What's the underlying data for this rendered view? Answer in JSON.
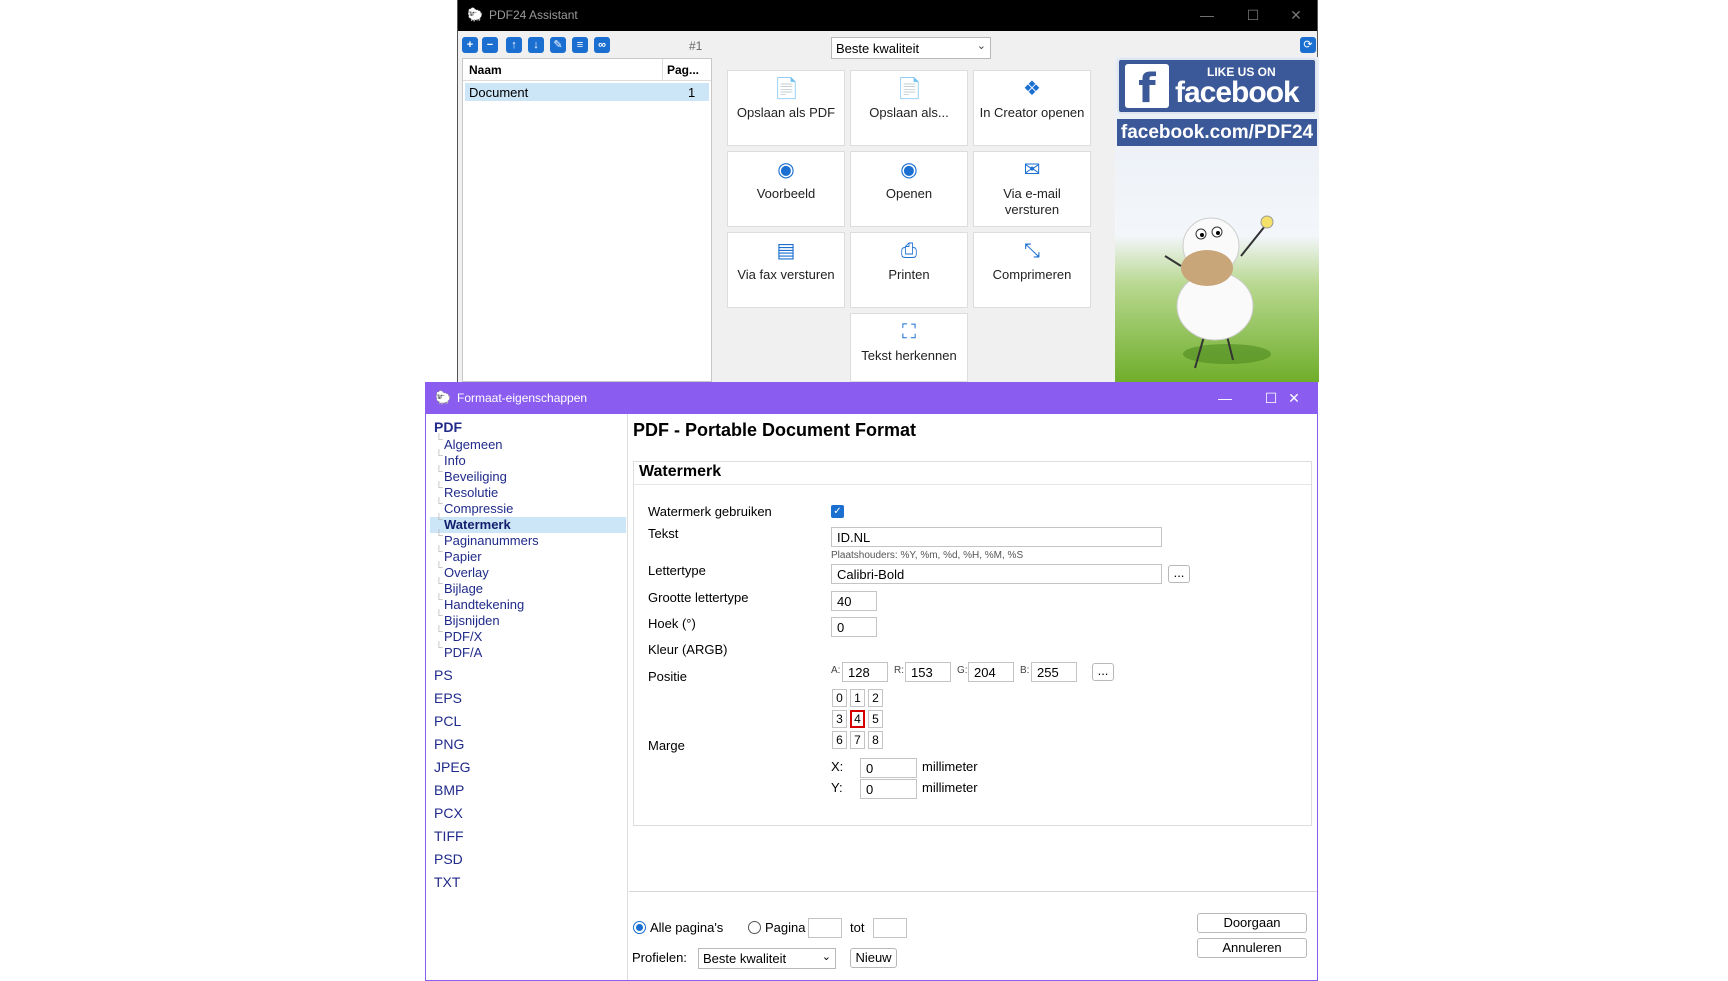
{
  "assistant": {
    "title": "PDF24 Assistant",
    "counter": "#1",
    "toolbar_icons": [
      "add-icon",
      "remove-icon",
      "move-up-icon",
      "move-down-icon",
      "edit-icon",
      "properties-icon",
      "view-icon"
    ],
    "list": {
      "col_name": "Naam",
      "col_pages": "Pag...",
      "rows": [
        {
          "name": "Document",
          "pages": "1"
        }
      ]
    },
    "quality": "Beste kwaliteit",
    "tiles": [
      {
        "label": "Opslaan als PDF",
        "icon": "save-pdf-icon"
      },
      {
        "label": "Opslaan als...",
        "icon": "save-as-icon"
      },
      {
        "label": "In Creator openen",
        "icon": "creator-icon"
      },
      {
        "label": "Voorbeeld",
        "icon": "eye-icon"
      },
      {
        "label": "Openen",
        "icon": "open-eye-icon"
      },
      {
        "label": "Via e-mail versturen",
        "icon": "mail-icon"
      },
      {
        "label": "Via fax versturen",
        "icon": "fax-icon"
      },
      {
        "label": "Printen",
        "icon": "printer-icon"
      },
      {
        "label": "Comprimeren",
        "icon": "compress-icon"
      },
      {
        "label": "Tekst herkennen",
        "icon": "ocr-icon"
      }
    ],
    "ad": {
      "like": "LIKE US ON",
      "brand": "facebook",
      "url": "facebook.com/PDF24"
    }
  },
  "props": {
    "title": "Formaat-eigenschappen",
    "nav": {
      "pdf": "PDF",
      "pdf_items": [
        "Algemeen",
        "Info",
        "Beveiliging",
        "Resolutie",
        "Compressie",
        "Watermerk",
        "Paginanummers",
        "Papier",
        "Overlay",
        "Bijlage",
        "Handtekening",
        "Bijsnijden",
        "PDF/X",
        "PDF/A"
      ],
      "active_index": 5,
      "formats": [
        "PS",
        "EPS",
        "PCL",
        "PNG",
        "JPEG",
        "BMP",
        "PCX",
        "TIFF",
        "PSD",
        "TXT"
      ]
    },
    "heading": "PDF - Portable Document Format",
    "section": "Watermerk",
    "fields": {
      "use_label": "Watermerk gebruiken",
      "use_checked": true,
      "text_label": "Tekst",
      "text_value": "ID.NL",
      "placeholder_hint": "Plaatshouders: %Y, %m, %d, %H, %M, %S",
      "font_label": "Lettertype",
      "font_value": "Calibri-Bold",
      "size_label": "Grootte lettertype",
      "size_value": "40",
      "angle_label": "Hoek (°)",
      "angle_value": "0",
      "color_label": "Kleur (ARGB)",
      "color": {
        "a_label": "A:",
        "a": "128",
        "r_label": "R:",
        "r": "153",
        "g_label": "G:",
        "g": "204",
        "b_label": "B:",
        "b": "255"
      },
      "position_label": "Positie",
      "positions": [
        "0",
        "1",
        "2",
        "3",
        "4",
        "5",
        "6",
        "7",
        "8"
      ],
      "position_selected": "4",
      "margin_label": "Marge",
      "margin_x_label": "X:",
      "margin_x": "0",
      "margin_y_label": "Y:",
      "margin_y": "0",
      "unit": "millimeter",
      "dots": "..."
    },
    "bottom": {
      "all_pages": "Alle pagina's",
      "page": "Pagina",
      "to": "tot",
      "page_from": "",
      "page_to": "",
      "profiles_label": "Profielen:",
      "profile_value": "Beste kwaliteit",
      "new_btn": "Nieuw",
      "continue_btn": "Doorgaan",
      "cancel_btn": "Annuleren"
    }
  },
  "colors": {
    "accent": "#8a5cf0",
    "selection": "#cce5f7",
    "link": "#1f2a8a",
    "facebook": "#3b5998",
    "icon_blue": "#1a6fd1"
  }
}
